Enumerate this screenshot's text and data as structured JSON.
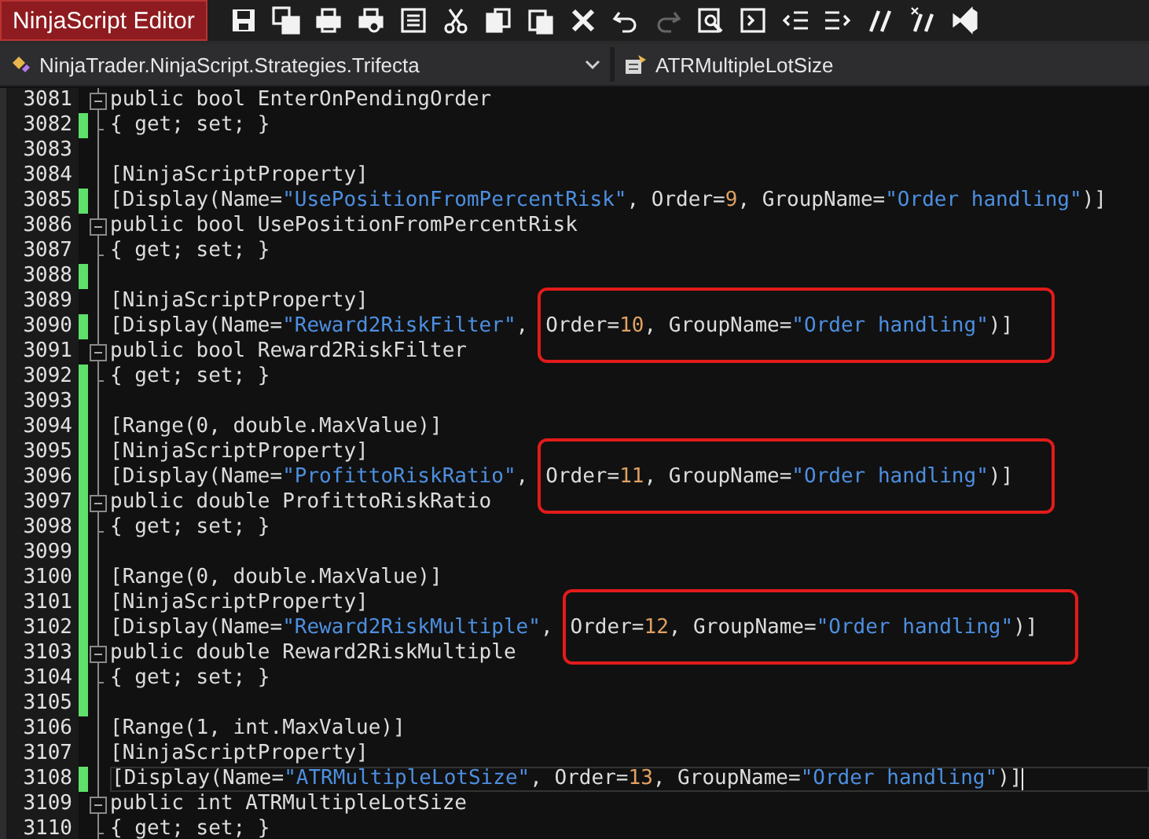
{
  "window": {
    "title": "NinjaScript Editor"
  },
  "toolbar": [
    {
      "kind": "save",
      "disabled": false
    },
    {
      "kind": "save-all",
      "disabled": false
    },
    {
      "kind": "print",
      "disabled": false
    },
    {
      "kind": "print-preview",
      "disabled": false
    },
    {
      "kind": "properties",
      "disabled": false
    },
    {
      "kind": "cut",
      "disabled": false
    },
    {
      "kind": "copy",
      "disabled": false
    },
    {
      "kind": "paste",
      "disabled": false
    },
    {
      "kind": "delete",
      "disabled": false
    },
    {
      "kind": "undo",
      "disabled": false
    },
    {
      "kind": "redo",
      "disabled": true
    },
    {
      "kind": "find",
      "disabled": false
    },
    {
      "kind": "console",
      "disabled": false
    },
    {
      "kind": "outdent",
      "disabled": false
    },
    {
      "kind": "indent",
      "disabled": false
    },
    {
      "kind": "comment",
      "disabled": false
    },
    {
      "kind": "uncomment",
      "disabled": false
    },
    {
      "kind": "visual-studio",
      "disabled": false
    }
  ],
  "navigation": {
    "type_selector": "NinjaTrader.NinjaScript.Strategies.Trifecta",
    "member_selector": "ATRMultipleLotSize"
  },
  "lines": [
    {
      "number": "3081",
      "changed": false,
      "kind": "fold_start",
      "current": false,
      "code": [
        {
          "t": "public bool EnterOnPendingOrder",
          "kind": "plain"
        }
      ]
    },
    {
      "number": "3082",
      "changed": true,
      "kind": "fold_end",
      "current": false,
      "code": [
        {
          "t": "{ get; set; }",
          "kind": "plain"
        }
      ]
    },
    {
      "number": "3083",
      "changed": false,
      "kind": "plain",
      "current": false
    },
    {
      "number": "3084",
      "changed": false,
      "kind": "plain",
      "current": false,
      "code": [
        {
          "t": "[NinjaScriptProperty]",
          "kind": "plain"
        }
      ]
    },
    {
      "number": "3085",
      "changed": true,
      "kind": "plain",
      "current": false,
      "code": [
        {
          "t": "[Display(Name=",
          "kind": "plain"
        },
        {
          "t": "\"UsePositionFromPercentRisk\"",
          "kind": "str"
        },
        {
          "t": ", Order=",
          "kind": "plain"
        },
        {
          "t": "9",
          "kind": "num"
        },
        {
          "t": ", GroupName=",
          "kind": "plain"
        },
        {
          "t": "\"Order handling\"",
          "kind": "str"
        },
        {
          "t": ")]",
          "kind": "plain"
        }
      ]
    },
    {
      "number": "3086",
      "changed": false,
      "kind": "fold_start",
      "current": false,
      "code": [
        {
          "t": "public bool UsePositionFromPercentRisk",
          "kind": "plain"
        }
      ]
    },
    {
      "number": "3087",
      "changed": false,
      "kind": "fold_end",
      "current": false,
      "code": [
        {
          "t": "{ get; set; }",
          "kind": "plain"
        }
      ]
    },
    {
      "number": "3088",
      "changed": true,
      "kind": "plain",
      "current": false
    },
    {
      "number": "3089",
      "changed": false,
      "kind": "plain",
      "current": false,
      "code": [
        {
          "t": "[NinjaScriptProperty]",
          "kind": "plain"
        }
      ]
    },
    {
      "number": "3090",
      "changed": true,
      "kind": "plain",
      "current": false,
      "code": [
        {
          "t": "[Display(Name=",
          "kind": "plain"
        },
        {
          "t": "\"Reward2RiskFilter\"",
          "kind": "str"
        },
        {
          "t": ",",
          "kind": "plain"
        }
      ],
      "boxed": [
        {
          "t": "Order=",
          "kind": "plain"
        },
        {
          "t": "10",
          "kind": "num"
        },
        {
          "t": ", GroupName=",
          "kind": "plain"
        },
        {
          "t": "\"Order handling\"",
          "kind": "str"
        },
        {
          "t": ")]",
          "kind": "plain"
        }
      ]
    },
    {
      "number": "3091",
      "changed": false,
      "kind": "fold_start",
      "current": false,
      "code": [
        {
          "t": "public bool Reward2RiskFilter",
          "kind": "plain"
        }
      ]
    },
    {
      "number": "3092",
      "changed": true,
      "kind": "fold_end",
      "current": false,
      "code": [
        {
          "t": "{ get; set; }",
          "kind": "plain"
        }
      ]
    },
    {
      "number": "3093",
      "changed": true,
      "kind": "plain",
      "current": false
    },
    {
      "number": "3094",
      "changed": true,
      "kind": "plain",
      "current": false,
      "code": [
        {
          "t": "[Range(0, double.MaxValue)]",
          "kind": "plain"
        }
      ]
    },
    {
      "number": "3095",
      "changed": true,
      "kind": "plain",
      "current": false,
      "code": [
        {
          "t": "[NinjaScriptProperty]",
          "kind": "plain"
        }
      ]
    },
    {
      "number": "3096",
      "changed": true,
      "kind": "plain",
      "current": false,
      "code": [
        {
          "t": "[Display(Name=",
          "kind": "plain"
        },
        {
          "t": "\"ProfittoRiskRatio\"",
          "kind": "str"
        },
        {
          "t": ",",
          "kind": "plain"
        }
      ],
      "boxed": [
        {
          "t": "Order=",
          "kind": "plain"
        },
        {
          "t": "11",
          "kind": "num"
        },
        {
          "t": ", GroupName=",
          "kind": "plain"
        },
        {
          "t": "\"Order handling\"",
          "kind": "str"
        },
        {
          "t": ")]",
          "kind": "plain"
        }
      ]
    },
    {
      "number": "3097",
      "changed": true,
      "kind": "fold_start",
      "current": false,
      "code": [
        {
          "t": "public double ProfittoRiskRatio",
          "kind": "plain"
        }
      ]
    },
    {
      "number": "3098",
      "changed": true,
      "kind": "fold_end",
      "current": false,
      "code": [
        {
          "t": "{ get; set; }",
          "kind": "plain"
        }
      ]
    },
    {
      "number": "3099",
      "changed": true,
      "kind": "plain",
      "current": false
    },
    {
      "number": "3100",
      "changed": true,
      "kind": "plain",
      "current": false,
      "code": [
        {
          "t": "[Range(0, double.MaxValue)]",
          "kind": "plain"
        }
      ]
    },
    {
      "number": "3101",
      "changed": true,
      "kind": "plain",
      "current": false,
      "code": [
        {
          "t": "[NinjaScriptProperty]",
          "kind": "plain"
        }
      ]
    },
    {
      "number": "3102",
      "changed": true,
      "kind": "plain",
      "current": false,
      "code": [
        {
          "t": "[Display(Name=",
          "kind": "plain"
        },
        {
          "t": "\"Reward2RiskMultiple\"",
          "kind": "str"
        },
        {
          "t": ",",
          "kind": "plain"
        }
      ],
      "boxed": [
        {
          "t": "Order=",
          "kind": "plain"
        },
        {
          "t": "12",
          "kind": "num"
        },
        {
          "t": ", GroupName=",
          "kind": "plain"
        },
        {
          "t": "\"Order handling\"",
          "kind": "str"
        },
        {
          "t": ")]",
          "kind": "plain"
        }
      ]
    },
    {
      "number": "3103",
      "changed": true,
      "kind": "fold_start",
      "current": false,
      "code": [
        {
          "t": "public double Reward2RiskMultiple",
          "kind": "plain"
        }
      ]
    },
    {
      "number": "3104",
      "changed": true,
      "kind": "fold_end",
      "current": false,
      "code": [
        {
          "t": "{ get; set; }",
          "kind": "plain"
        }
      ]
    },
    {
      "number": "3105",
      "changed": true,
      "kind": "plain",
      "current": false
    },
    {
      "number": "3106",
      "changed": false,
      "kind": "plain",
      "current": false,
      "code": [
        {
          "t": "[Range(1, int.MaxValue)]",
          "kind": "plain"
        }
      ]
    },
    {
      "number": "3107",
      "changed": false,
      "kind": "plain",
      "current": false,
      "code": [
        {
          "t": "[NinjaScriptProperty]",
          "kind": "plain"
        }
      ]
    },
    {
      "number": "3108",
      "changed": true,
      "kind": "plain",
      "current": true,
      "code": [
        {
          "t": "[Display(Name=",
          "kind": "plain"
        },
        {
          "t": "\"ATRMultipleLotSize\"",
          "kind": "str"
        },
        {
          "t": ", Order=",
          "kind": "plain"
        },
        {
          "t": "13",
          "kind": "num"
        },
        {
          "t": ", GroupName=",
          "kind": "plain"
        },
        {
          "t": "\"Order handling\"",
          "kind": "str"
        },
        {
          "t": ")]",
          "kind": "plain"
        }
      ]
    },
    {
      "number": "3109",
      "changed": false,
      "kind": "fold_start",
      "current": false,
      "code": [
        {
          "t": "public int ATRMultipleLotSize",
          "kind": "plain"
        }
      ]
    },
    {
      "number": "3110",
      "changed": false,
      "kind": "fold_end",
      "current": false,
      "code": [
        {
          "t": "{ get; set; }",
          "kind": "plain"
        }
      ]
    }
  ]
}
